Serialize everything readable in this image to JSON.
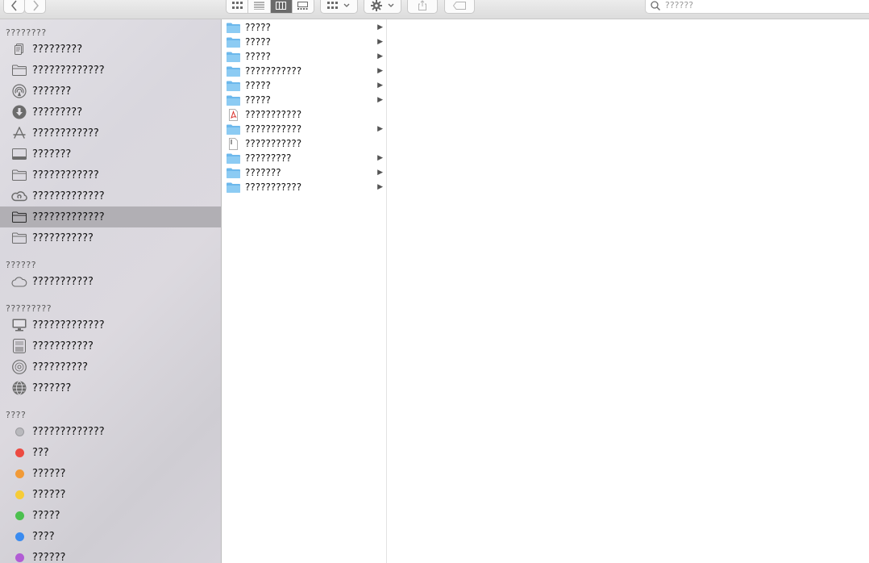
{
  "toolbar": {
    "back_icon": "chevron-left-icon",
    "forward_icon": "chevron-right-icon",
    "view_modes": [
      "icon-view-icon",
      "list-view-icon",
      "column-view-icon",
      "gallery-view-icon"
    ],
    "active_view": "column-view-icon",
    "search_placeholder": "??????"
  },
  "sidebar": {
    "sections": [
      {
        "heading": "????????",
        "items": [
          {
            "label": "?????????",
            "icon": "recents-icon"
          },
          {
            "label": "?????????????",
            "icon": "folder-icon"
          },
          {
            "label": "???????",
            "icon": "airdrop-icon"
          },
          {
            "label": "?????????",
            "icon": "downloads-icon"
          },
          {
            "label": "????????????",
            "icon": "applications-icon"
          },
          {
            "label": "???????",
            "icon": "desktop-icon"
          },
          {
            "label": "????????????",
            "icon": "folder-icon"
          },
          {
            "label": "?????????????",
            "icon": "creative-cloud-icon"
          },
          {
            "label": "?????????????",
            "icon": "folder-icon",
            "selected": true
          },
          {
            "label": "???????????",
            "icon": "folder-icon"
          }
        ]
      },
      {
        "heading": "??????",
        "items": [
          {
            "label": "???????????",
            "icon": "cloud-icon"
          }
        ]
      },
      {
        "heading": "?????????",
        "items": [
          {
            "label": "?????????????",
            "icon": "computer-icon"
          },
          {
            "label": "???????????",
            "icon": "hard-drive-icon"
          },
          {
            "label": "??????????",
            "icon": "optical-disc-icon"
          },
          {
            "label": "???????",
            "icon": "network-icon"
          }
        ]
      },
      {
        "heading": "????",
        "items": [
          {
            "label": "?????????????",
            "icon": "tag-gray-icon",
            "color": "#b9b9bd"
          },
          {
            "label": "???",
            "icon": "tag-red-icon",
            "color": "#ec4a41"
          },
          {
            "label": "??????",
            "icon": "tag-orange-icon",
            "color": "#f19a37"
          },
          {
            "label": "??????",
            "icon": "tag-yellow-icon",
            "color": "#f6cc37"
          },
          {
            "label": "?????",
            "icon": "tag-green-icon",
            "color": "#4cc04f"
          },
          {
            "label": "????",
            "icon": "tag-blue-icon",
            "color": "#3a8bf0"
          },
          {
            "label": "??????",
            "icon": "tag-purple-icon",
            "color": "#b15cd4"
          }
        ]
      }
    ]
  },
  "column1": {
    "items": [
      {
        "name": "?????",
        "kind": "folder",
        "has_children": true
      },
      {
        "name": "?????",
        "kind": "folder",
        "has_children": true
      },
      {
        "name": "?????",
        "kind": "folder",
        "has_children": true
      },
      {
        "name": "???????????",
        "kind": "folder",
        "has_children": true
      },
      {
        "name": "?????",
        "kind": "folder",
        "has_children": true
      },
      {
        "name": "?????",
        "kind": "folder",
        "has_children": true
      },
      {
        "name": "???????????",
        "kind": "pdf",
        "has_children": false
      },
      {
        "name": "???????????",
        "kind": "folder",
        "has_children": true
      },
      {
        "name": "???????????",
        "kind": "file",
        "has_children": false
      },
      {
        "name": "?????????",
        "kind": "folder",
        "has_children": true
      },
      {
        "name": "???????",
        "kind": "folder",
        "has_children": true
      },
      {
        "name": "???????????",
        "kind": "folder",
        "has_children": true
      }
    ]
  },
  "colors": {
    "folder_blue": "#6cb8ec",
    "sidebar_selected": "#b1afb4",
    "pdf_red": "#d9302a"
  }
}
